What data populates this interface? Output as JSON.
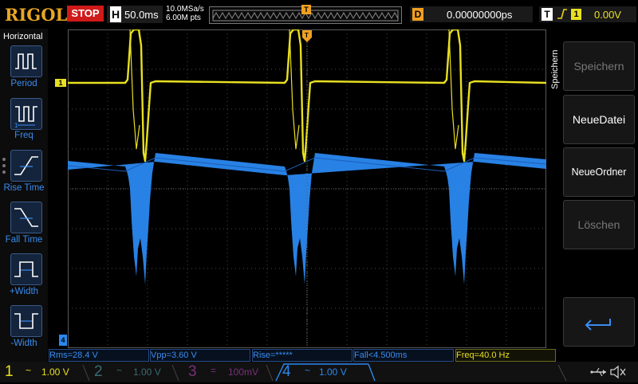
{
  "topbar": {
    "brand": "RIGOL",
    "run_status": "STOP",
    "timebase_letter": "H",
    "timebase_value": "50.0ms",
    "sample_rate": "10.0MSa/s",
    "memory_depth": "6.00M pts",
    "delay_letter": "D",
    "delay_value": "0.00000000ps",
    "trigger_letter": "T",
    "trigger_channel": "1",
    "trigger_level": "0.00V",
    "trigger_marker": "T"
  },
  "left_panel": {
    "title": "Horizontal",
    "items": [
      {
        "label": "Period",
        "icon": "period-icon"
      },
      {
        "label": "Freq",
        "icon": "freq-icon"
      },
      {
        "label": "Rise Time",
        "icon": "rise-time-icon"
      },
      {
        "label": "Fall Time",
        "icon": "fall-time-icon"
      },
      {
        "label": "+Width",
        "icon": "plus-width-icon"
      },
      {
        "label": "-Width",
        "icon": "minus-width-icon"
      }
    ]
  },
  "right_menu": {
    "title": "Speichern",
    "items": [
      {
        "label": "Speichern",
        "enabled": false
      },
      {
        "label": "NeueDatei",
        "enabled": true
      },
      {
        "label": "NeueOrdner",
        "enabled": true
      },
      {
        "label": "Löschen",
        "enabled": false
      },
      {
        "label": "",
        "icon": "return-icon",
        "enabled": true
      }
    ]
  },
  "measurements": [
    {
      "text": "Rms=28.4 V",
      "channel": "4"
    },
    {
      "text": "Vpp=3.60 V",
      "channel": "4"
    },
    {
      "text": "Rise=*****",
      "channel": "4"
    },
    {
      "text": "Fall<4.500ms",
      "channel": "4"
    },
    {
      "text": "Freq=40.0 Hz",
      "channel": "1"
    }
  ],
  "channels": [
    {
      "number": "1",
      "coupling": "~",
      "scale": "1.00 V",
      "active": true,
      "color": "#e8e020"
    },
    {
      "number": "2",
      "coupling": "~",
      "scale": "1.00 V",
      "active": false,
      "color": "#3a8a9a"
    },
    {
      "number": "3",
      "coupling": "=",
      "scale": "100mV",
      "active": false,
      "color": "#b040b0"
    },
    {
      "number": "4",
      "coupling": "~",
      "scale": "1.00 V",
      "active": true,
      "color": "#2a88f0"
    }
  ],
  "markers": {
    "ch1_marker": "1",
    "ch4_marker": "4"
  },
  "status": {
    "usb_icon": "usb-icon",
    "mute_icon": "speaker-mute-icon"
  },
  "colors": {
    "ch1": "#e8e020",
    "ch4": "#2a88f0",
    "accent": "#f0a020",
    "stop": "#d01a1a",
    "brand": "#e8a623"
  }
}
